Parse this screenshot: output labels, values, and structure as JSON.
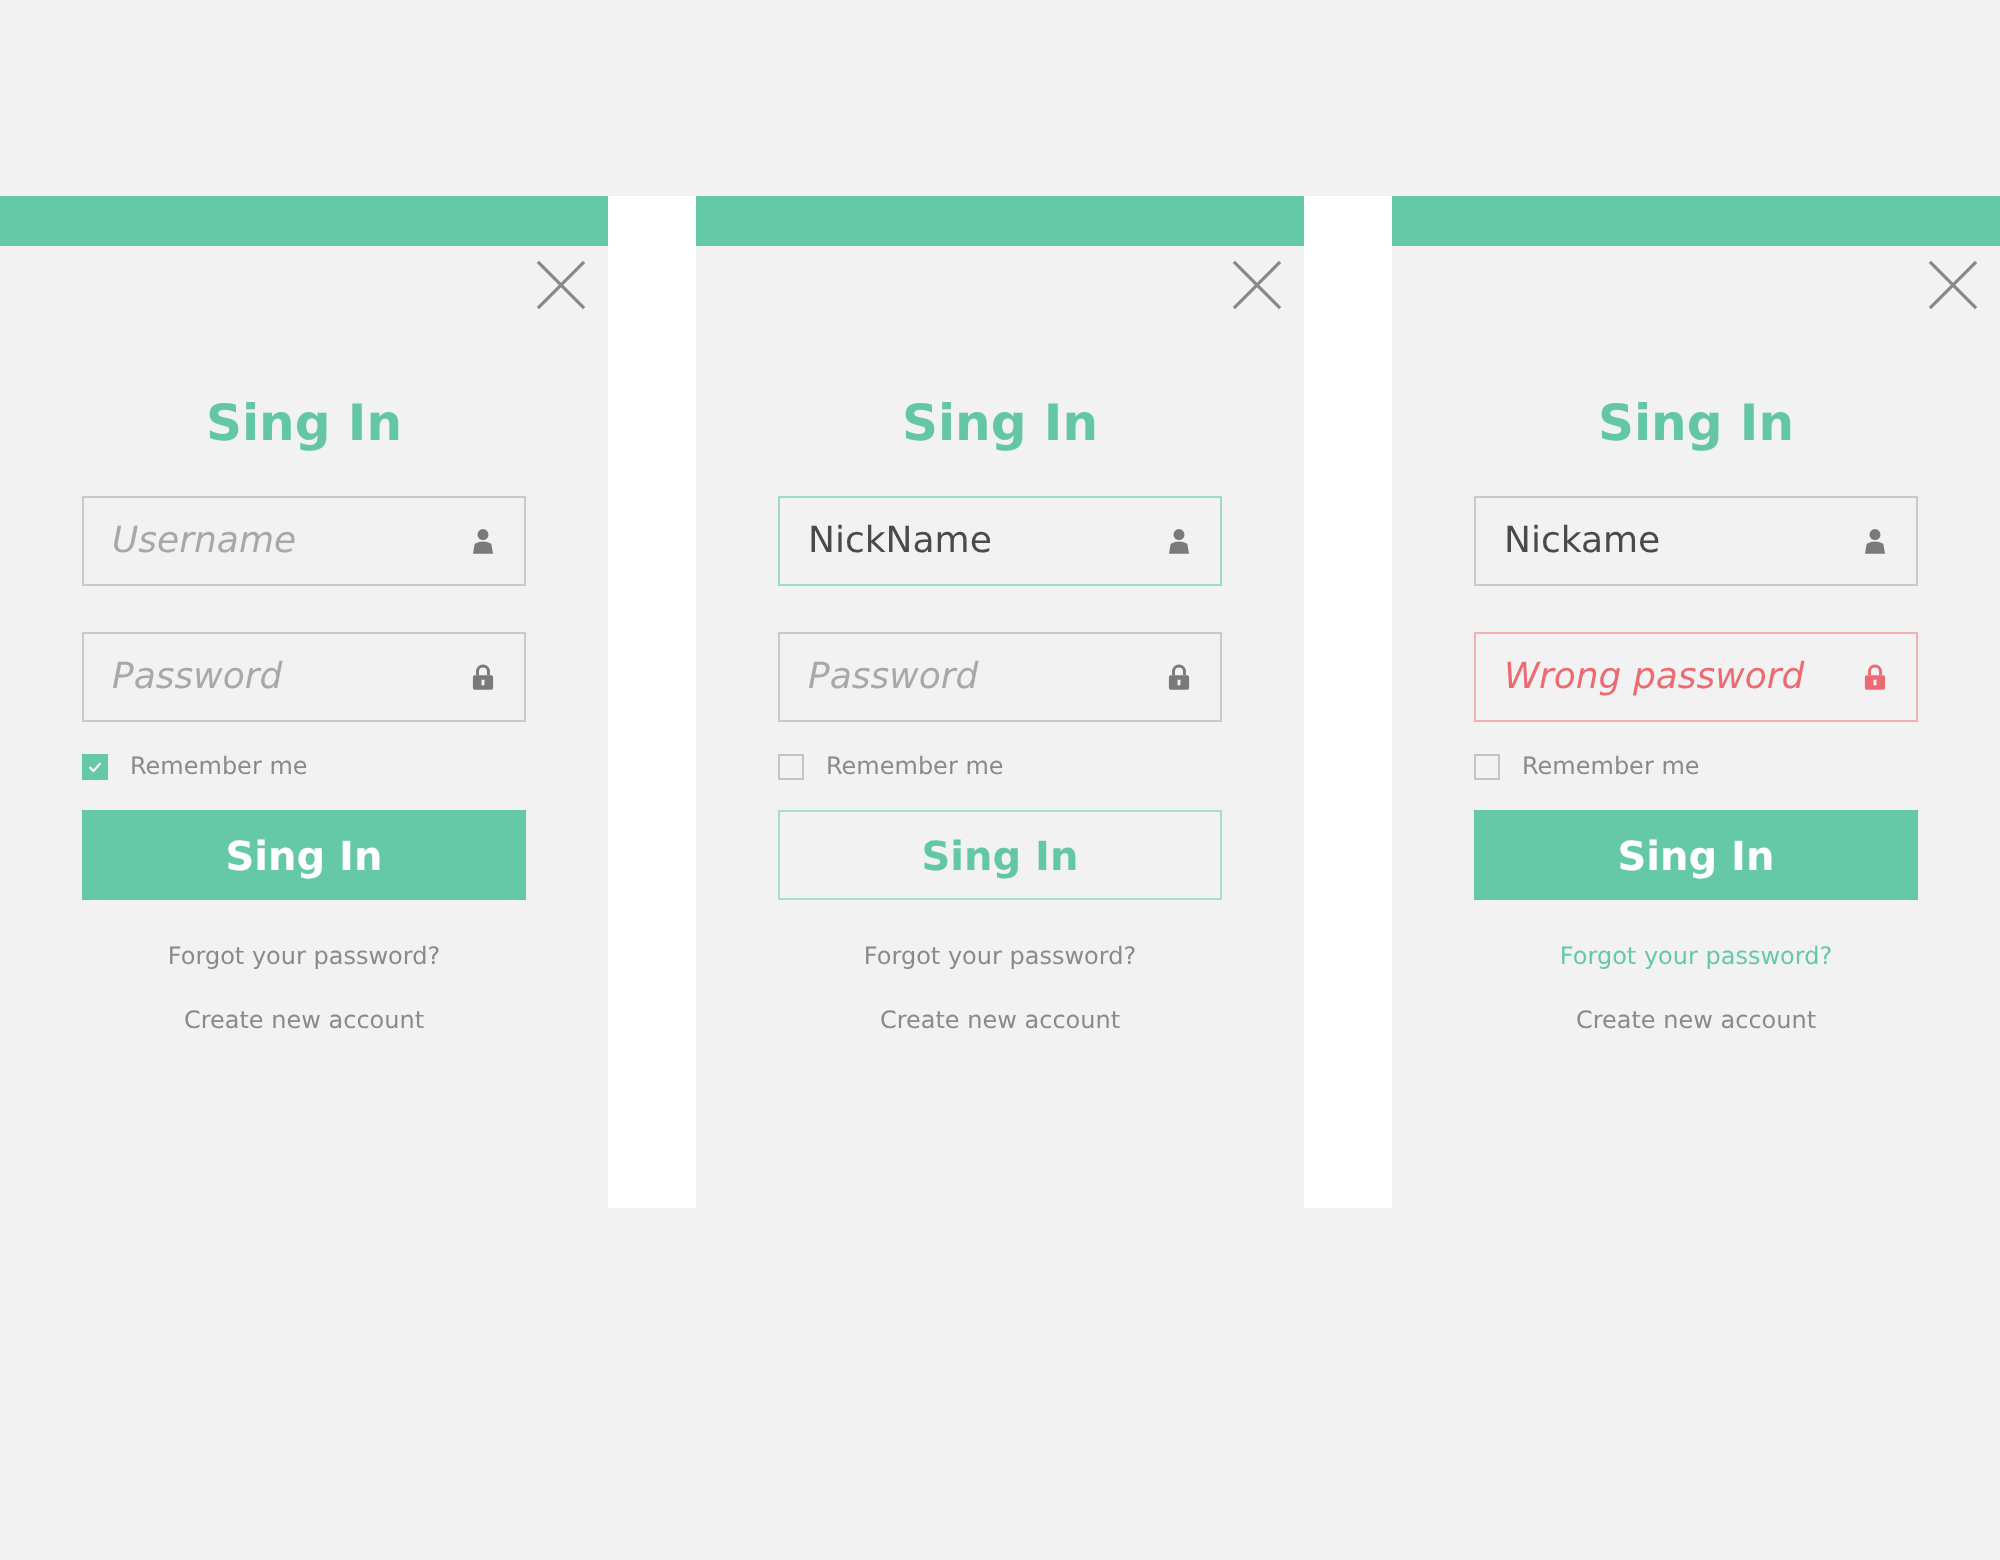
{
  "panels": [
    {
      "title": "Sing In",
      "fields": [
        {
          "kind": "user",
          "placeholder": "Username",
          "focused": false,
          "error": false
        },
        {
          "kind": "password",
          "placeholder": "Password",
          "focused": false,
          "error": false
        }
      ],
      "remember": {
        "label": "Remember me",
        "checked": true
      },
      "button": {
        "label": "Sing In",
        "outlined": false
      },
      "links": [
        {
          "label": "Forgot your password?",
          "highlighted": false
        },
        {
          "label": "Create new account",
          "highlighted": false
        }
      ]
    },
    {
      "title": "Sing In",
      "fields": [
        {
          "kind": "user",
          "value": "NickName",
          "focused": true,
          "error": false
        },
        {
          "kind": "password",
          "placeholder": "Password",
          "focused": false,
          "error": false
        }
      ],
      "remember": {
        "label": "Remember me",
        "checked": false
      },
      "button": {
        "label": "Sing In",
        "outlined": true
      },
      "links": [
        {
          "label": "Forgot your password?",
          "highlighted": false
        },
        {
          "label": "Create new account",
          "highlighted": false
        }
      ]
    },
    {
      "title": "Sing In",
      "fields": [
        {
          "kind": "user",
          "value": "Nickame",
          "focused": false,
          "error": false
        },
        {
          "kind": "password",
          "placeholder": "Wrong password",
          "focused": false,
          "error": true
        }
      ],
      "remember": {
        "label": "Remember me",
        "checked": false
      },
      "button": {
        "label": "Sing In",
        "outlined": false
      },
      "links": [
        {
          "label": "Forgot your password?",
          "highlighted": true
        },
        {
          "label": "Create new account",
          "highlighted": false
        }
      ]
    }
  ]
}
